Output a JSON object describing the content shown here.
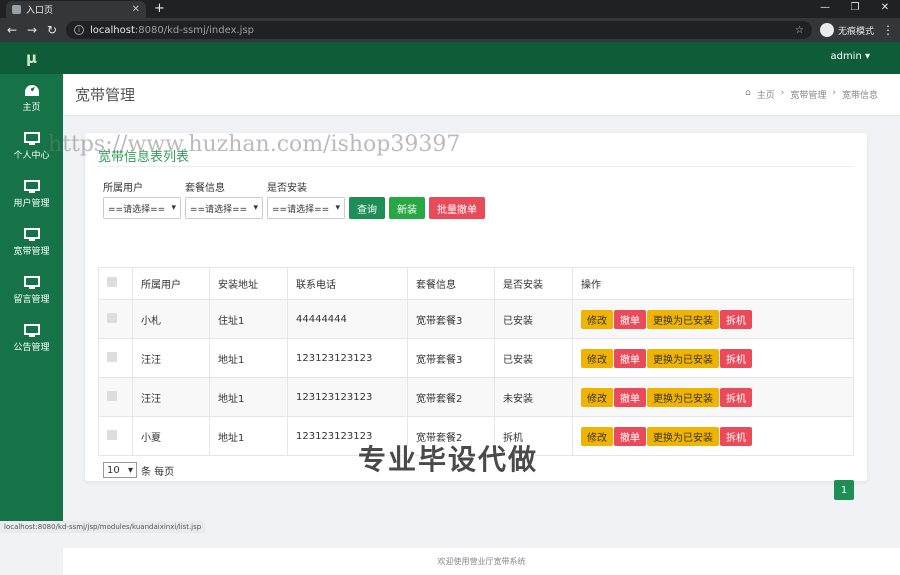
{
  "browser": {
    "tab_title": "入口页",
    "url_host": "localhost",
    "url_path": ":8080/kd-ssmj/index.jsp",
    "incognito_label": "无痕模式",
    "status_url": "localhost:8080/kd-ssmj/jsp/modules/kuandaixinxi/list.jsp"
  },
  "sidebar": {
    "logo": "μ",
    "items": [
      {
        "label": "主页",
        "icon": "dashboard-icon"
      },
      {
        "label": "个人中心",
        "icon": "monitor-icon"
      },
      {
        "label": "用户管理",
        "icon": "monitor-icon"
      },
      {
        "label": "宽带管理",
        "icon": "monitor-icon"
      },
      {
        "label": "留言管理",
        "icon": "monitor-icon"
      },
      {
        "label": "公告管理",
        "icon": "monitor-icon"
      }
    ]
  },
  "topbar": {
    "user": "admin ▾"
  },
  "header": {
    "title": "宽带管理",
    "breadcrumb": [
      "主页",
      "宽带管理",
      "宽带信息"
    ]
  },
  "card": {
    "title": "宽带信息表列表",
    "filters": [
      {
        "label": "所属用户",
        "value": "==请选择=="
      },
      {
        "label": "套餐信息",
        "value": "==请选择=="
      },
      {
        "label": "是否安装",
        "value": "==请选择=="
      }
    ],
    "buttons": {
      "search": "查询",
      "add": "新装",
      "batch_delete": "批量撤单"
    },
    "columns": [
      "所属用户",
      "安装地址",
      "联系电话",
      "套餐信息",
      "是否安装",
      "操作"
    ],
    "rows": [
      {
        "user": "小札",
        "address": "住址1",
        "phone": "44444444",
        "plan": "宽带套餐3",
        "status": "已安装"
      },
      {
        "user": "汪汪",
        "address": "地址1",
        "phone": "123123123123",
        "plan": "宽带套餐3",
        "status": "已安装"
      },
      {
        "user": "汪汪",
        "address": "地址1",
        "phone": "123123123123",
        "plan": "宽带套餐2",
        "status": "未安装"
      },
      {
        "user": "小夏",
        "address": "地址1",
        "phone": "123123123123",
        "plan": "宽带套餐2",
        "status": "拆机"
      }
    ],
    "row_actions": {
      "edit": "修改",
      "cancel": "撤单",
      "set_installed": "更换为已安装",
      "remove": "拆机"
    },
    "pager": {
      "page_size": "10",
      "suffix": "条 每页",
      "current_page": "1"
    }
  },
  "watermark": "https://www.huzhan.com/ishop39397",
  "promo": "专业毕设代做",
  "footer": "欢迎使用营业厅宽带系统"
}
